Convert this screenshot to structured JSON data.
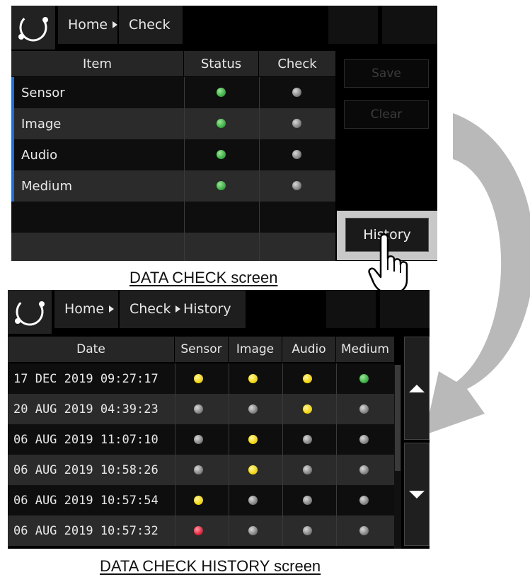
{
  "screen1": {
    "breadcrumb": {
      "home": "Home",
      "current": "Check"
    },
    "columns": [
      "Item",
      "Status",
      "Check"
    ],
    "rows": [
      {
        "item": "Sensor",
        "status": "green",
        "check": "gray"
      },
      {
        "item": "Image",
        "status": "green",
        "check": "gray"
      },
      {
        "item": "Audio",
        "status": "green",
        "check": "gray"
      },
      {
        "item": "Medium",
        "status": "green",
        "check": "gray"
      }
    ],
    "buttons": {
      "save": "Save",
      "clear": "Clear",
      "history": "History"
    },
    "caption": "DATA CHECK screen"
  },
  "screen2": {
    "breadcrumb": {
      "home": "Home",
      "check": "Check",
      "current": "History"
    },
    "columns": [
      "Date",
      "Sensor",
      "Image",
      "Audio",
      "Medium"
    ],
    "rows": [
      {
        "date": "17 DEC 2019 09:27:17",
        "sensor": "yellow",
        "image": "yellow",
        "audio": "yellow",
        "medium": "green"
      },
      {
        "date": "20 AUG 2019 04:39:23",
        "sensor": "gray",
        "image": "gray",
        "audio": "yellow",
        "medium": "gray"
      },
      {
        "date": "06 AUG 2019 11:07:10",
        "sensor": "gray",
        "image": "yellow",
        "audio": "gray",
        "medium": "gray"
      },
      {
        "date": "06 AUG 2019 10:58:26",
        "sensor": "gray",
        "image": "yellow",
        "audio": "gray",
        "medium": "gray"
      },
      {
        "date": "06 AUG 2019 10:57:54",
        "sensor": "yellow",
        "image": "gray",
        "audio": "gray",
        "medium": "gray"
      },
      {
        "date": "06 AUG 2019 10:57:32",
        "sensor": "red",
        "image": "gray",
        "audio": "gray",
        "medium": "gray"
      }
    ],
    "caption": "DATA CHECK HISTORY screen"
  },
  "icons": {
    "logo": "ring-logo-icon",
    "hand": "pointing-hand-icon",
    "arrow": "curved-arrow-icon",
    "scroll_up": "triangle-up-icon",
    "scroll_down": "triangle-down-icon"
  },
  "colors": {
    "accent": "#2a6cc4",
    "green": "#2fa83a",
    "yellow": "#f0d000",
    "red": "#e0142e",
    "gray": "#777777"
  }
}
